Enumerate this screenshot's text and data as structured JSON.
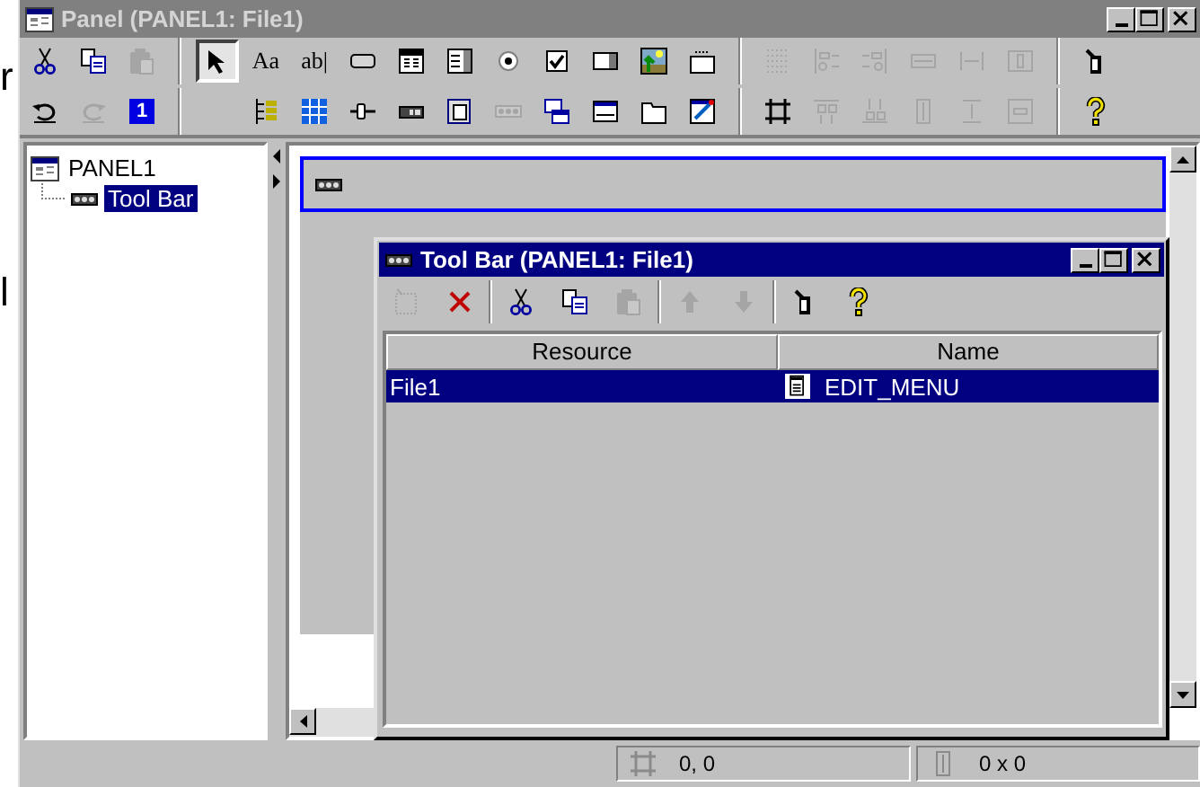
{
  "background_window": {
    "texts": [
      "r",
      "l"
    ]
  },
  "window": {
    "title": "Panel (PANEL1: File1)",
    "active": false
  },
  "toolbar": {
    "rows": [
      [
        [
          {
            "kind": "cut",
            "disabled": false,
            "selected": false
          },
          {
            "kind": "copy",
            "disabled": false,
            "selected": false
          },
          {
            "kind": "paste",
            "disabled": true,
            "selected": false
          }
        ],
        [
          {
            "kind": "pointer",
            "disabled": false,
            "selected": true
          },
          {
            "kind": "glyph",
            "text": "Aa",
            "disabled": false,
            "selected": false
          },
          {
            "kind": "glyph",
            "text": "ab|",
            "disabled": false,
            "selected": false
          },
          {
            "kind": "button",
            "disabled": false,
            "selected": false
          },
          {
            "kind": "list",
            "disabled": false,
            "selected": false
          },
          {
            "kind": "spinlist",
            "disabled": false,
            "selected": false
          },
          {
            "kind": "radio",
            "disabled": false,
            "selected": false
          },
          {
            "kind": "checkbox",
            "disabled": false,
            "selected": false
          },
          {
            "kind": "field",
            "disabled": false,
            "selected": false
          },
          {
            "kind": "picture",
            "disabled": false,
            "selected": false
          },
          {
            "kind": "labelbox",
            "disabled": false,
            "selected": false
          }
        ],
        [
          {
            "kind": "grid",
            "disabled": true,
            "selected": false
          },
          {
            "kind": "alignleft",
            "disabled": true,
            "selected": false
          },
          {
            "kind": "alignright",
            "disabled": true,
            "selected": false
          },
          {
            "kind": "hsize",
            "disabled": true,
            "selected": false
          },
          {
            "kind": "hspace",
            "disabled": true,
            "selected": false
          },
          {
            "kind": "hcenter",
            "disabled": true,
            "selected": false
          }
        ],
        [
          {
            "kind": "wand",
            "disabled": false,
            "selected": false
          }
        ]
      ],
      [
        [
          {
            "kind": "undo",
            "disabled": false,
            "selected": false
          },
          {
            "kind": "redo",
            "disabled": true,
            "selected": false
          },
          {
            "kind": "number",
            "text": "1",
            "disabled": false,
            "selected": false
          }
        ],
        [
          {
            "kind": "blank"
          },
          {
            "kind": "tree",
            "disabled": false,
            "selected": false
          },
          {
            "kind": "table",
            "disabled": false,
            "selected": false
          },
          {
            "kind": "slider",
            "disabled": false,
            "selected": false
          },
          {
            "kind": "progress",
            "disabled": false,
            "selected": false
          },
          {
            "kind": "doc",
            "disabled": false,
            "selected": false
          },
          {
            "kind": "tbar",
            "disabled": true,
            "selected": false
          },
          {
            "kind": "windows",
            "disabled": false,
            "selected": false
          },
          {
            "kind": "status",
            "disabled": false,
            "selected": false
          },
          {
            "kind": "tab",
            "disabled": false,
            "selected": false
          },
          {
            "kind": "edit",
            "disabled": false,
            "selected": false
          }
        ],
        [
          {
            "kind": "crop",
            "disabled": false,
            "selected": false
          },
          {
            "kind": "aligntop",
            "disabled": true,
            "selected": false
          },
          {
            "kind": "alignbottom",
            "disabled": true,
            "selected": false
          },
          {
            "kind": "vsize",
            "disabled": true,
            "selected": false
          },
          {
            "kind": "vspace",
            "disabled": true,
            "selected": false
          },
          {
            "kind": "vcenter",
            "disabled": true,
            "selected": false
          }
        ],
        [
          {
            "kind": "help",
            "disabled": false,
            "selected": false
          }
        ]
      ]
    ]
  },
  "tree": {
    "items": [
      {
        "label": "PANEL1",
        "kind": "panel",
        "selected": false,
        "children": [
          {
            "label": "Tool Bar",
            "kind": "tbar",
            "selected": true
          }
        ]
      }
    ]
  },
  "canvas": {
    "toolbar_element": {
      "selected": true
    }
  },
  "child_window": {
    "title": "Tool Bar (PANEL1: File1)",
    "active": true,
    "toolbar": [
      [
        {
          "kind": "new",
          "disabled": true
        },
        {
          "kind": "delete",
          "disabled": false
        }
      ],
      [
        {
          "kind": "cut",
          "disabled": false
        },
        {
          "kind": "copy",
          "disabled": false
        },
        {
          "kind": "paste",
          "disabled": true
        }
      ],
      [
        {
          "kind": "up",
          "disabled": true
        },
        {
          "kind": "down",
          "disabled": true
        }
      ],
      [
        {
          "kind": "wand",
          "disabled": false
        },
        {
          "kind": "help",
          "disabled": false
        }
      ]
    ],
    "table": {
      "columns": [
        "Resource",
        "Name"
      ],
      "rows": [
        {
          "cells": [
            "File1",
            "EDIT_MENU"
          ],
          "selected": true
        }
      ]
    }
  },
  "status_bar": {
    "position": "0, 0",
    "size": "0 x 0"
  }
}
